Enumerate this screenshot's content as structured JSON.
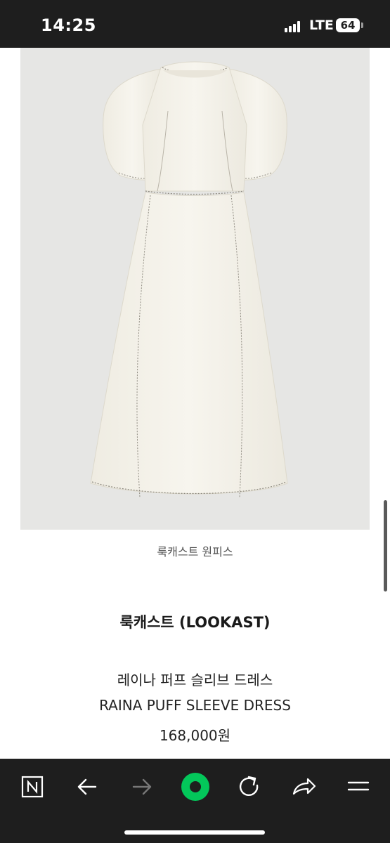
{
  "status_bar": {
    "time": "14:25",
    "network": "LTE",
    "battery": "64"
  },
  "product": {
    "image_alt_icon": "dress-image",
    "caption": "룩캐스트 원피스",
    "brand": "룩캐스트 (LOOKAST)",
    "name_ko": "레이나 퍼프 슬리브 드레스",
    "name_en": "RAINA PUFF SLEEVE DRESS",
    "price": "168,000원"
  },
  "toolbar": {
    "items": [
      "naver-home-icon",
      "back-arrow-icon",
      "forward-arrow-icon",
      "green-dot-icon",
      "refresh-icon",
      "share-icon",
      "menu-icon"
    ],
    "accent": "#03c75a"
  }
}
